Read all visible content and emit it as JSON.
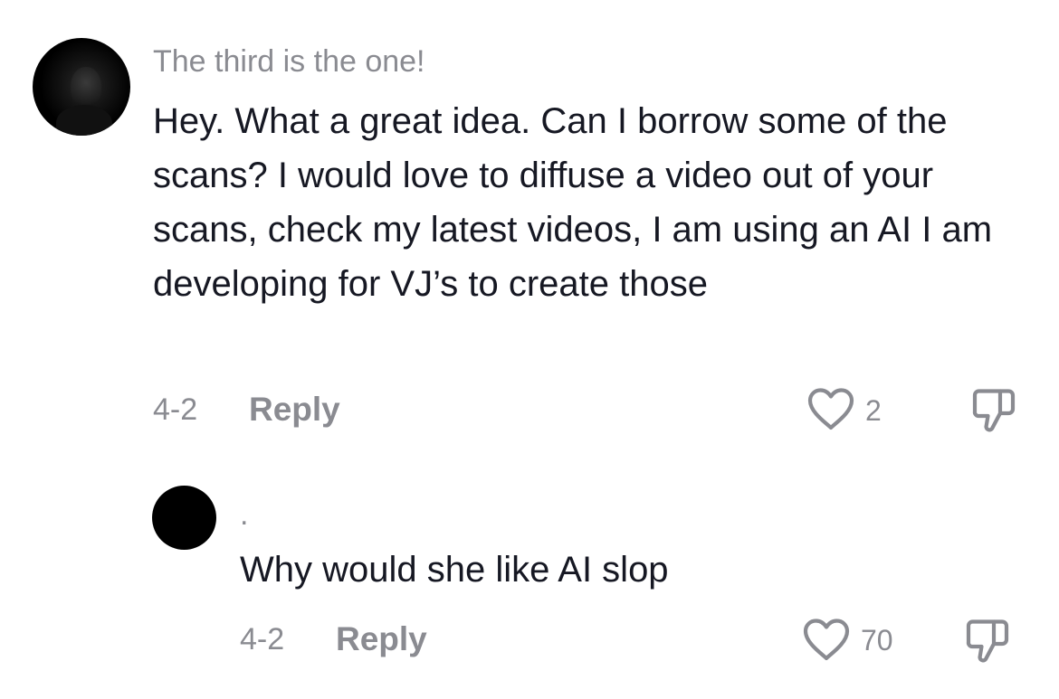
{
  "comments": [
    {
      "username": "The third is the one!",
      "text": "Hey. What a great idea. Can I borrow some of the scans? I would love to diffuse a video out of your scans, check my latest videos, I am using an AI I am developing for VJ’s to create those",
      "date": "4-2",
      "reply_label": "Reply",
      "like_count": "2",
      "like_icon": "heart-outline-icon",
      "dislike_icon": "thumbs-down-outline-icon"
    },
    {
      "username": ".",
      "text": "Why would she like AI slop",
      "date": "4-2",
      "reply_label": "Reply",
      "like_count": "70",
      "like_icon": "heart-outline-icon",
      "dislike_icon": "thumbs-down-outline-icon"
    }
  ],
  "colors": {
    "primary_text": "#161823",
    "secondary_text": "#8a8b91",
    "background": "#ffffff",
    "avatar": "#000000"
  }
}
